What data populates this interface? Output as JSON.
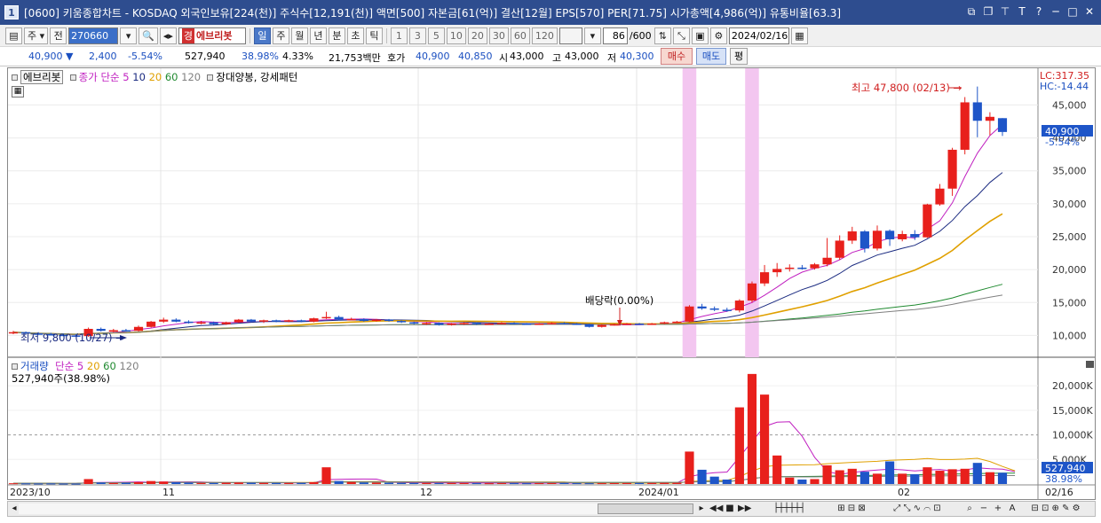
{
  "window": {
    "title": "[0600] 키움종합차트 - KOSDAQ 외국인보유[224(천)] 주식수[12,191(천)] 액면[500] 자본금[61(억)] 결산[12월] EPS[570] PER[71.75] 시가총액[4,986(억)] 유통비율[63.3]",
    "app_number": "1"
  },
  "toolbar": {
    "period_label": "주",
    "prev_label": "전",
    "stock_code": "270660",
    "stock_tag": "경",
    "stock_name": "에브리봇",
    "periods": [
      "일",
      "주",
      "월",
      "년",
      "분",
      "초",
      "틱"
    ],
    "selected_period": "일",
    "intervals": [
      "1",
      "3",
      "5",
      "10",
      "20",
      "30",
      "60",
      "120"
    ],
    "count_value": "86",
    "count_total": "/600",
    "date_value": "2024/02/16"
  },
  "info": {
    "price": "40,900 ▼",
    "change": "2,400",
    "change_pct": "-5.54%",
    "volume": "527,940",
    "volume_ratio": "38.98%",
    "turnover": "4.33%",
    "amount": "21,753백만",
    "ask_label": "호가",
    "ask1": "40,900",
    "ask2": "40,850",
    "open_label": "시",
    "open": "43,000",
    "high_label": "고",
    "high": "43,000",
    "low_label": "저",
    "low": "40,300",
    "buy_label": "매수",
    "sell_label": "매도",
    "avg_label": "평"
  },
  "price_legend": {
    "name": "에브리봇",
    "ma_label": "종가 단순",
    "ma_periods": [
      "5",
      "10",
      "20",
      "60",
      "120"
    ],
    "pattern_label": "장대양봉, 강세패턴"
  },
  "volume_legend": {
    "name": "거래량",
    "ma_label": "단순",
    "ma_periods": [
      "5",
      "20",
      "60",
      "120"
    ],
    "current": "527,940주(38.98%)"
  },
  "annotations": {
    "high": "최고 47,800 (02/13) →",
    "low": "최저 9,800 (10/27) →",
    "dividend": "배당락(0.00%)",
    "lc": "LC:317.35",
    "hc": "HC:-14.44",
    "current_price": "40,900",
    "current_pct": "-5.54%",
    "current_volume": "527,940",
    "current_volume_pct": "38.98%"
  },
  "colors": {
    "up": "#e8201c",
    "down": "#1e55c8",
    "ma5": "#c020c0",
    "ma10": "#1a2a80",
    "ma20": "#e0a000",
    "ma60": "#208a30",
    "ma120": "#808080",
    "highlight": "#f3c6f0",
    "title_bar": "#2e4d8f"
  },
  "chart_data": {
    "type": "candlestick",
    "price_axis": {
      "ticks": [
        "45,000",
        "40,000",
        "35,000",
        "30,000",
        "25,000",
        "20,000",
        "15,000",
        "10,000"
      ],
      "range": [
        7500,
        49500
      ]
    },
    "volume_axis": {
      "ticks": [
        "20,000K",
        "15,000K",
        "10,000K",
        "5,000K"
      ],
      "range": [
        0,
        24000
      ]
    },
    "x_labels": [
      "2023/10",
      "11",
      "12",
      "2024/01",
      "02",
      "02/16"
    ],
    "candles": [
      [
        10400,
        10700,
        10200,
        10500
      ],
      [
        10500,
        10600,
        10200,
        10300
      ],
      [
        10300,
        10500,
        10100,
        10200
      ],
      [
        10200,
        10400,
        10000,
        10100
      ],
      [
        10100,
        10300,
        9900,
        10000
      ],
      [
        10000,
        10200,
        9800,
        9900
      ],
      [
        9900,
        11200,
        9800,
        11000
      ],
      [
        11000,
        11200,
        10600,
        10700
      ],
      [
        10700,
        11000,
        10500,
        10800
      ],
      [
        10800,
        11000,
        10600,
        10700
      ],
      [
        10700,
        11500,
        10600,
        11300
      ],
      [
        11300,
        12200,
        11200,
        12100
      ],
      [
        12100,
        12700,
        11900,
        12400
      ],
      [
        12400,
        12600,
        12000,
        12100
      ],
      [
        12100,
        12300,
        11800,
        11900
      ],
      [
        11900,
        12200,
        11700,
        12000
      ],
      [
        12000,
        12100,
        11600,
        11700
      ],
      [
        11700,
        12100,
        11600,
        12000
      ],
      [
        12000,
        12500,
        11900,
        12400
      ],
      [
        12400,
        12500,
        12000,
        12100
      ],
      [
        12100,
        12400,
        11900,
        12300
      ],
      [
        12300,
        12400,
        12000,
        12100
      ],
      [
        12100,
        12400,
        12000,
        12300
      ],
      [
        12300,
        12400,
        12000,
        12100
      ],
      [
        12100,
        12700,
        12000,
        12600
      ],
      [
        12600,
        13600,
        12500,
        12800
      ],
      [
        12800,
        13000,
        12300,
        12400
      ],
      [
        12400,
        12700,
        12300,
        12500
      ],
      [
        12500,
        12600,
        12100,
        12200
      ],
      [
        12200,
        12500,
        12100,
        12400
      ],
      [
        12400,
        12500,
        12100,
        12200
      ],
      [
        12200,
        12300,
        11900,
        12000
      ],
      [
        12000,
        12100,
        11700,
        11800
      ],
      [
        11800,
        12000,
        11600,
        11900
      ],
      [
        11900,
        12000,
        11500,
        11600
      ],
      [
        11600,
        11900,
        11500,
        11800
      ],
      [
        11800,
        12000,
        11600,
        11900
      ],
      [
        11900,
        12000,
        11600,
        11700
      ],
      [
        11700,
        11900,
        11600,
        11800
      ],
      [
        11800,
        12000,
        11700,
        11900
      ],
      [
        11900,
        12000,
        11700,
        11800
      ],
      [
        11800,
        11900,
        11600,
        11700
      ],
      [
        11700,
        11900,
        11600,
        11800
      ],
      [
        11800,
        12000,
        11700,
        11900
      ],
      [
        11900,
        12000,
        11700,
        11800
      ],
      [
        11800,
        11900,
        11600,
        11700
      ],
      [
        11700,
        11800,
        11200,
        11300
      ],
      [
        11300,
        11700,
        11200,
        11600
      ],
      [
        11600,
        11800,
        11500,
        11700
      ],
      [
        11700,
        11900,
        11600,
        11800
      ],
      [
        11800,
        11900,
        11600,
        11700
      ],
      [
        11700,
        11900,
        11600,
        11800
      ],
      [
        11800,
        12100,
        11700,
        12000
      ],
      [
        12000,
        12200,
        11900,
        12100
      ],
      [
        12100,
        14600,
        12000,
        14400
      ],
      [
        14400,
        14800,
        13900,
        14100
      ],
      [
        14100,
        14400,
        13700,
        13900
      ],
      [
        13900,
        14200,
        13600,
        13800
      ],
      [
        13800,
        15500,
        13500,
        15300
      ],
      [
        15300,
        18200,
        15000,
        17900
      ],
      [
        17900,
        20700,
        17500,
        19600
      ],
      [
        19600,
        21000,
        18900,
        20100
      ],
      [
        20100,
        20800,
        19700,
        20300
      ],
      [
        20300,
        20700,
        20000,
        20200
      ],
      [
        20200,
        21000,
        20000,
        20800
      ],
      [
        20800,
        24800,
        20500,
        21800
      ],
      [
        21800,
        25200,
        21500,
        24400
      ],
      [
        24400,
        26500,
        23900,
        25800
      ],
      [
        25800,
        26000,
        22600,
        23200
      ],
      [
        23200,
        26700,
        22900,
        25900
      ],
      [
        25900,
        26100,
        23600,
        24600
      ],
      [
        24600,
        25900,
        24300,
        25400
      ],
      [
        25400,
        26000,
        24500,
        24900
      ],
      [
        24900,
        30000,
        24800,
        29900
      ],
      [
        29900,
        33000,
        29700,
        32300
      ],
      [
        32300,
        38500,
        31200,
        38200
      ],
      [
        38200,
        46200,
        37500,
        45400
      ],
      [
        45400,
        47800,
        40100,
        42600
      ],
      [
        42600,
        43900,
        40400,
        43200
      ],
      [
        43000,
        43000,
        40300,
        40900
      ]
    ],
    "volumes": [
      150,
      120,
      100,
      110,
      90,
      80,
      1000,
      300,
      200,
      250,
      400,
      600,
      500,
      350,
      280,
      220,
      200,
      260,
      300,
      250,
      230,
      200,
      220,
      210,
      380,
      3400,
      600,
      400,
      300,
      280,
      250,
      220,
      200,
      210,
      180,
      200,
      190,
      170,
      160,
      180,
      170,
      160,
      175,
      190,
      180,
      170,
      160,
      170,
      180,
      190,
      200,
      210,
      230,
      240,
      6600,
      2900,
      1500,
      900,
      15600,
      22400,
      18200,
      5800,
      1300,
      900,
      1000,
      3800,
      2800,
      3100,
      2500,
      2100,
      4600,
      2100,
      2000,
      3400,
      2700,
      3000,
      3100,
      4300,
      2400,
      2300,
      527.94
    ]
  }
}
